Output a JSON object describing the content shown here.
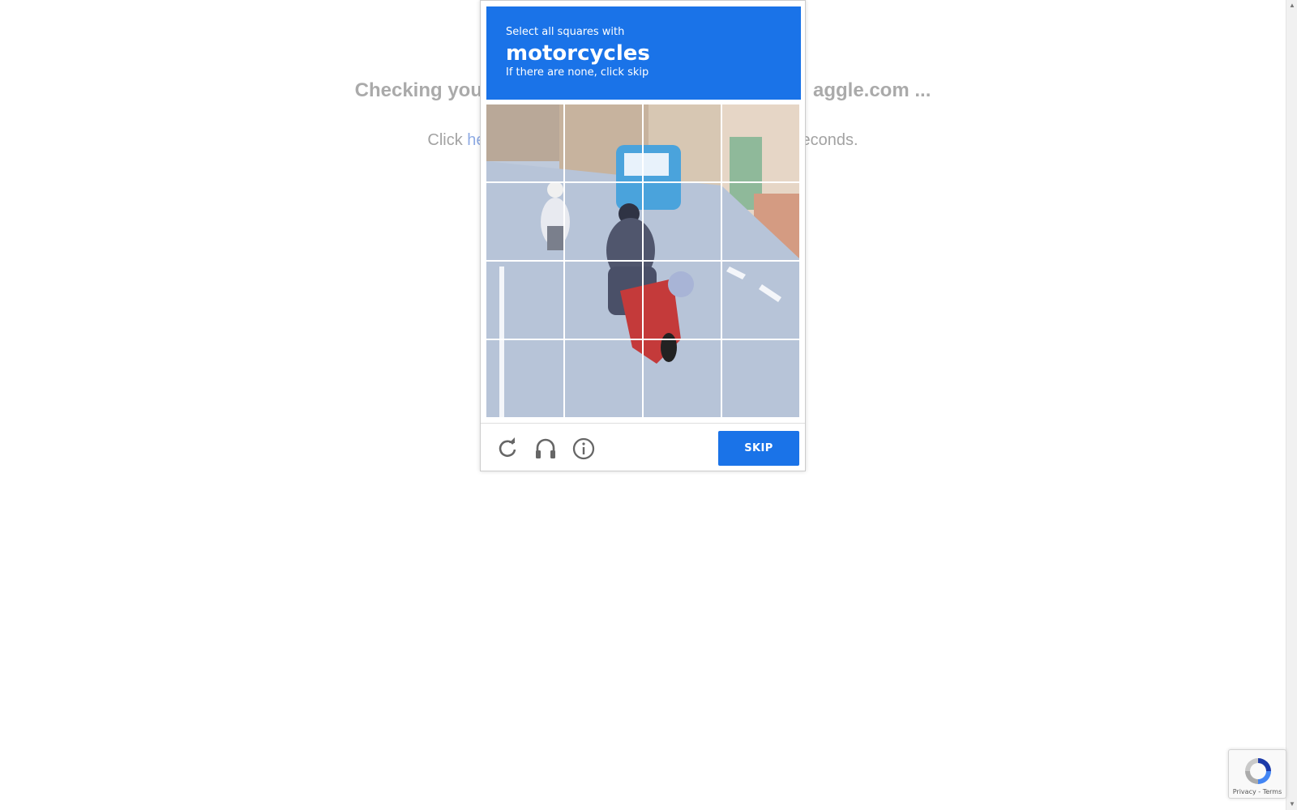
{
  "background_page": {
    "heading_left": "Checking you",
    "heading_right": "aggle.com ...",
    "text_prefix": "Click ",
    "link_text": "he",
    "text_suffix": "econds."
  },
  "challenge": {
    "line1": "Select all squares with",
    "target": "motorcycles",
    "line3": "If there are none, click skip",
    "skip_label": "SKIP",
    "accent_color": "#1a73e8",
    "grid": {
      "rows": 4,
      "cols": 4
    },
    "icons": [
      "reload-icon",
      "headphones-icon",
      "info-icon"
    ]
  },
  "recaptcha_badge": {
    "privacy": "Privacy",
    "separator": " - ",
    "terms": "Terms"
  }
}
